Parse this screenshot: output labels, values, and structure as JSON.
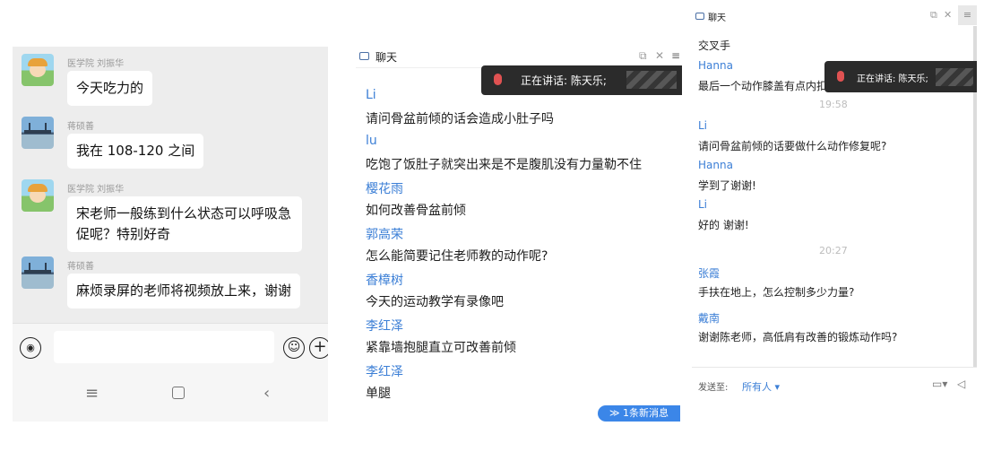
{
  "left_chat": {
    "messages": [
      {
        "sender": "医学院 刘振华",
        "text": "今天吃力的",
        "avatar": "cartoon-avatar"
      },
      {
        "sender": "蒋硕善",
        "text": "我在 108-120 之间",
        "avatar": "bridge-photo-avatar"
      },
      {
        "sender": "医学院 刘振华",
        "text": "宋老师一般练到什么状态可以呼吸急促呢？特别好奇",
        "avatar": "cartoon-avatar"
      },
      {
        "sender": "蒋硕善",
        "text": "麻烦录屏的老师将视频放上来，谢谢",
        "avatar": "bridge-photo-avatar"
      }
    ],
    "input": {
      "voice_icon": "voice-icon",
      "emoji_icon": "emoji-icon",
      "plus_icon": "plus-icon"
    },
    "nav": {
      "menu": "≡",
      "home": "▢",
      "back": "‹"
    }
  },
  "middle_chat": {
    "title": "聊天",
    "speaking": "正在讲话: 陈天乐;",
    "messages": [
      {
        "name": "Li",
        "text": "请问骨盆前倾的话会造成小肚子吗"
      },
      {
        "name": "lu",
        "text": "吃饱了饭肚子就突出来是不是腹肌没有力量勒不住"
      },
      {
        "name": "樱花雨",
        "text": "如何改善骨盆前倾"
      },
      {
        "name": "郭高荣",
        "text": "怎么能简要记住老师教的动作呢?"
      },
      {
        "name": "香樟树",
        "text": "今天的运动教学有录像吧"
      },
      {
        "name": "李红泽",
        "text": "紧靠墙抱腿直立可改善前倾"
      },
      {
        "name": "李红泽",
        "text": "单腿"
      }
    ],
    "new_messages": "≫ 1条新消息"
  },
  "right_chat": {
    "title": "聊天",
    "speaking": "正在讲话: 陈天乐;",
    "line_top": "交叉手",
    "messages_a": [
      {
        "name": "Hanna",
        "text": "最后一个动作膝盖有点内扣"
      }
    ],
    "time1": "19:58",
    "messages_b": [
      {
        "name": "Li",
        "text": "请问骨盆前倾的话要做什么动作修复呢?"
      },
      {
        "name": "Hanna",
        "text": "学到了谢谢!"
      },
      {
        "name": "Li",
        "text": "好的 谢谢!"
      }
    ],
    "time2": "20:27",
    "messages_c": [
      {
        "name": "张霞",
        "text": "手扶在地上，怎么控制多少力量?"
      },
      {
        "name": "戴南",
        "text": "谢谢陈老师，高低肩有改善的锻炼动作吗?"
      }
    ],
    "send_to_label": "发送至:",
    "send_to_value": "所有人 ▾"
  }
}
